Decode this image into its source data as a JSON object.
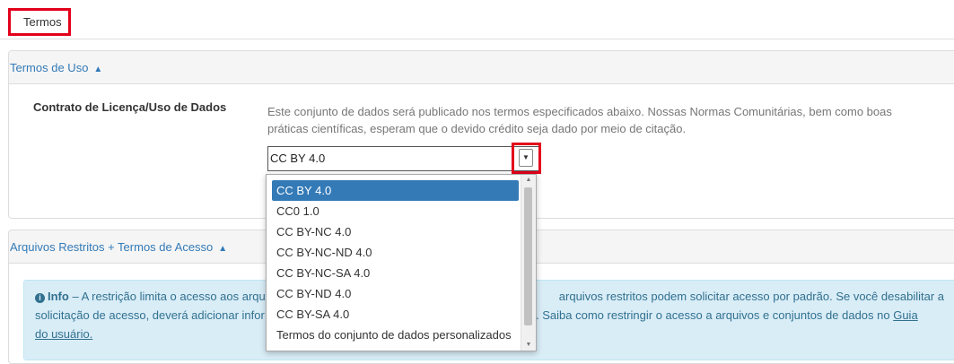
{
  "tabs": [
    {
      "label": "Termos"
    }
  ],
  "terms_section": {
    "title": "Termos de Uso",
    "field_label": "Contrato de Licença/Uso de Dados",
    "help_text": "Este conjunto de dados será publicado nos termos especificados abaixo. Nossas Normas Comunitárias, bem como boas práticas científicas, esperam que o devido crédito seja dado por meio de citação.",
    "select_value": "CC BY 4.0"
  },
  "restricted_section": {
    "title": "Arquivos Restritos + Termos de Acesso",
    "info_label": "Info",
    "info_visible_line1a": " – A restrição limita o acesso aos arqu",
    "info_visible_line1b": "arquivos restritos podem solicitar acesso por padrão. Se você desabilitar a",
    "info_visible_line2a": "solicitação de acesso, deverá adicionar infor",
    "info_visible_line2b": "o. Saiba como restringir o acesso a arquivos e conjuntos de dados no ",
    "info_link": "Guia",
    "info_visible_line3": "do usuário."
  },
  "license_dropdown": {
    "options": [
      "CC BY 4.0",
      "CC0 1.0",
      "CC BY-NC 4.0",
      "CC BY-NC-ND 4.0",
      "CC BY-NC-SA 4.0",
      "CC BY-ND 4.0",
      "CC BY-SA 4.0",
      "Termos do conjunto de dados personalizados"
    ],
    "selected_index": 0
  },
  "colors": {
    "accent": "#337ab7",
    "highlight_box": "#e3001b",
    "info_bg": "#d9edf7",
    "info_text": "#31708f"
  }
}
